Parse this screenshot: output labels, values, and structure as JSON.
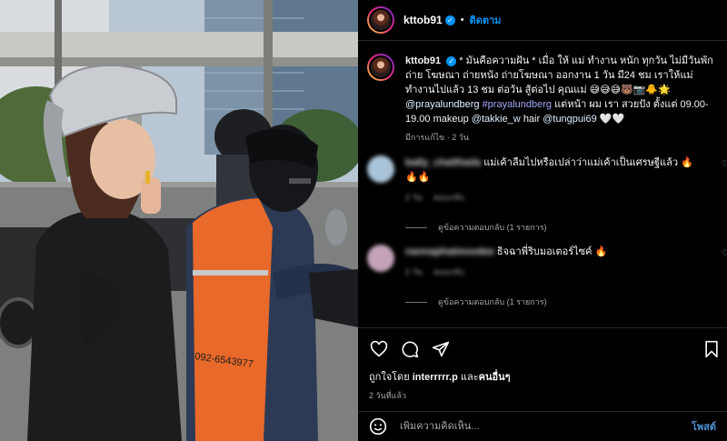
{
  "header": {
    "username": "kttob91",
    "dot": "•",
    "follow_label": "ติดตาม"
  },
  "caption": {
    "username": "kttob91",
    "text_1": "* มันคือความฝัน * เมื่อ ให้ แม่ ทำงาน หนัก ทุกวัน ไม่มีวันพัก ถ่าย โฆษณา ถ่ายหนัง ถ่ายโฆษณา ออกงาน 1 วัน มี24 ชม เราให้แม่ทำงานไปแล้ว 13 ชม ต่อวัน สู้ต่อไป คุณแม่ 😅😅😅🐻📷🐥🌟",
    "mention_1": "@prayalundberg",
    "hashtag_1": "#prayalundberg",
    "text_2": "แต่หน้า ผม เรา สวยปัง ตั้งแต่ 09.00-19.00 makeup",
    "mention_2": "@takkie_w",
    "text_3": "hair",
    "mention_3": "@tungpui69",
    "text_4": "🤍🤍",
    "meta": "มีการแก้ไข · 2 วัน"
  },
  "comments": [
    {
      "username": "bally_chatthada",
      "text": "แม่เค้าลืมไปหรือเปล่าว่าแม่เค้าเป็นเศรษฐีแล้ว 🔥🔥🔥",
      "time": "2 วัน",
      "reply_label": "ตอบกลับ",
      "view_replies": "ดูข้อความตอบกลับ (1 รายการ)",
      "avatar_color": "#a9c3d8"
    },
    {
      "username": "nannaphatmoodee",
      "text": "ธิจฉาพี่ริบมอเตอร์ไซค์ 🔥",
      "time": "2 วัน",
      "reply_label": "ตอบกลับ",
      "view_replies": "ดูข้อความตอบกลับ (1 รายการ)",
      "avatar_color": "#c4a3b8"
    }
  ],
  "likes": {
    "prefix": "ถูกใจโดย",
    "user": "interrrrr.p",
    "mid": "และ",
    "others": "คนอื่นๆ"
  },
  "time_ago": "2 วันที่แล้ว",
  "add_comment": {
    "placeholder": "เพิ่มความคิดเห็น...",
    "post_label": "โพสต์"
  },
  "photo": {
    "vest_text": "092-6543977"
  },
  "colors": {
    "accent": "#0095f6",
    "background": "#000000",
    "vest": "#e8692a"
  },
  "icons": [
    "verified-icon",
    "heart-icon",
    "comment-icon",
    "share-icon",
    "bookmark-icon",
    "emoji-icon"
  ]
}
